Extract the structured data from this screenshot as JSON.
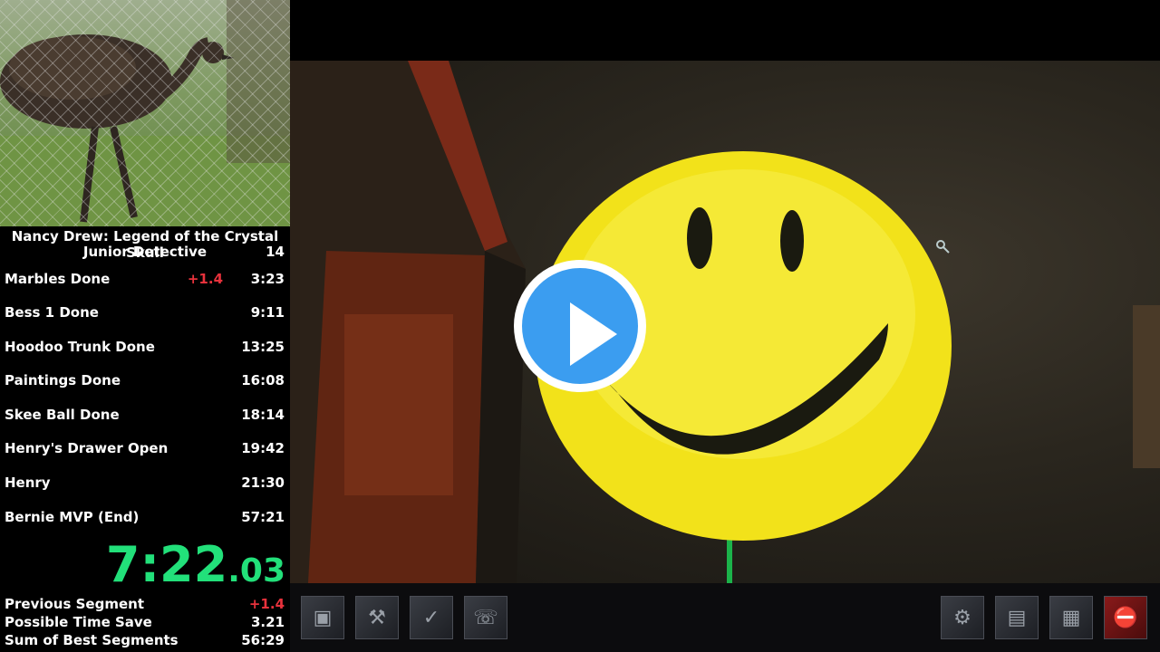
{
  "splits_panel": {
    "game_title": "Nancy Drew: Legend of the Crystal Skull",
    "category": "Junior Detective",
    "attempt_count": "14",
    "splits": [
      {
        "name": "Marbles Done",
        "delta": "+1.4",
        "time": "3:23"
      },
      {
        "name": "Bess 1 Done",
        "delta": "",
        "time": "9:11"
      },
      {
        "name": "Hoodoo Trunk Done",
        "delta": "",
        "time": "13:25"
      },
      {
        "name": "Paintings Done",
        "delta": "",
        "time": "16:08"
      },
      {
        "name": "Skee Ball Done",
        "delta": "",
        "time": "18:14"
      },
      {
        "name": "Henry's Drawer Open",
        "delta": "",
        "time": "19:42"
      },
      {
        "name": "Henry",
        "delta": "",
        "time": "21:30"
      },
      {
        "name": "Bernie MVP (End)",
        "delta": "",
        "time": "57:21"
      }
    ],
    "timer": {
      "main": "7:22",
      "fraction": ".03"
    },
    "info": [
      {
        "label": "Previous Segment",
        "value": "+1.4"
      },
      {
        "label": "Possible Time Save",
        "value": "3.21"
      },
      {
        "label": "Sum of Best Segments",
        "value": "56:29"
      }
    ]
  },
  "colors": {
    "timer": "#22e07a",
    "delta_behind": "#e8323c",
    "play_button": "#3b9df0",
    "smiley": "#f2e21a"
  },
  "inventory": {
    "left_slots": [
      "box-icon",
      "hammer-icon",
      "checklist-icon",
      "phone-icon"
    ],
    "right_slots": [
      "gear-icon",
      "folder-icon",
      "disk-icon",
      "exit-icon"
    ]
  },
  "webcam": {
    "subject": "emu-icon"
  },
  "video": {
    "play_icon": "play-icon"
  }
}
